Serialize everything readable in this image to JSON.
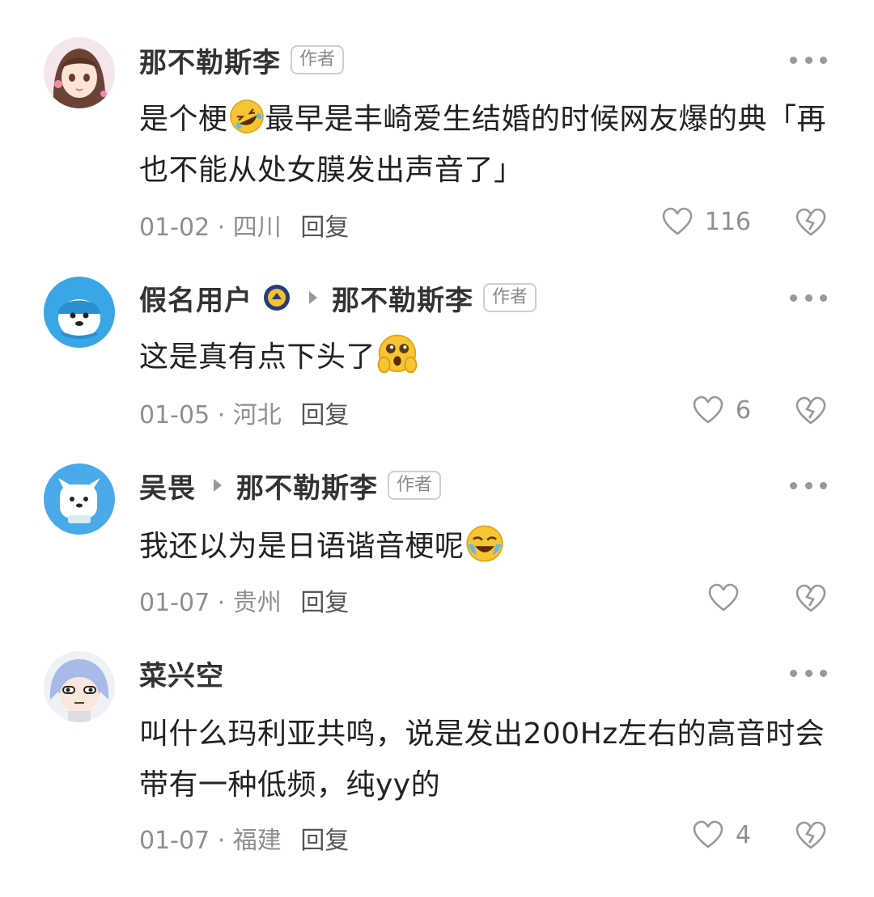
{
  "comments": [
    {
      "user": "那不勒斯李",
      "badge": "作者",
      "text_before": "是个梗",
      "text_after": "最早是丰崎爱生结婚的时候网友爆的典「再也不能从处女膜发出声音了」",
      "date": "01-02",
      "location": "四川",
      "reply_label": "回复",
      "likes": "116",
      "avatar_icon": "anime-girl-avatar",
      "emoji": "rofl-emoji"
    },
    {
      "user": "假名用户",
      "reply_to": "那不勒斯李",
      "badge": "作者",
      "text_before": "这是真有点下头了",
      "text_after": "",
      "date": "01-05",
      "location": "河北",
      "reply_label": "回复",
      "likes": "6",
      "avatar_icon": "blue-mascot-avatar",
      "emoji": "shocked-emoji"
    },
    {
      "user": "吴畏",
      "reply_to": "那不勒斯李",
      "badge": "作者",
      "text_before": "我还以为是日语谐音梗呢",
      "text_after": "",
      "date": "01-07",
      "location": "贵州",
      "reply_label": "回复",
      "likes": "",
      "avatar_icon": "blue-dog-avatar",
      "emoji": "crying-laugh-emoji"
    },
    {
      "user": "菜兴空",
      "text_before": "叫什么玛利亚共鸣，说是发出200Hz左右的高音时会带有一种低频，纯yy的",
      "text_after": "",
      "date": "01-07",
      "location": "福建",
      "reply_label": "回复",
      "likes": "4",
      "avatar_icon": "chibi-character-avatar"
    }
  ],
  "colors": {
    "text": "#222222",
    "meta": "#8f8f8f",
    "icon": "#999999"
  }
}
